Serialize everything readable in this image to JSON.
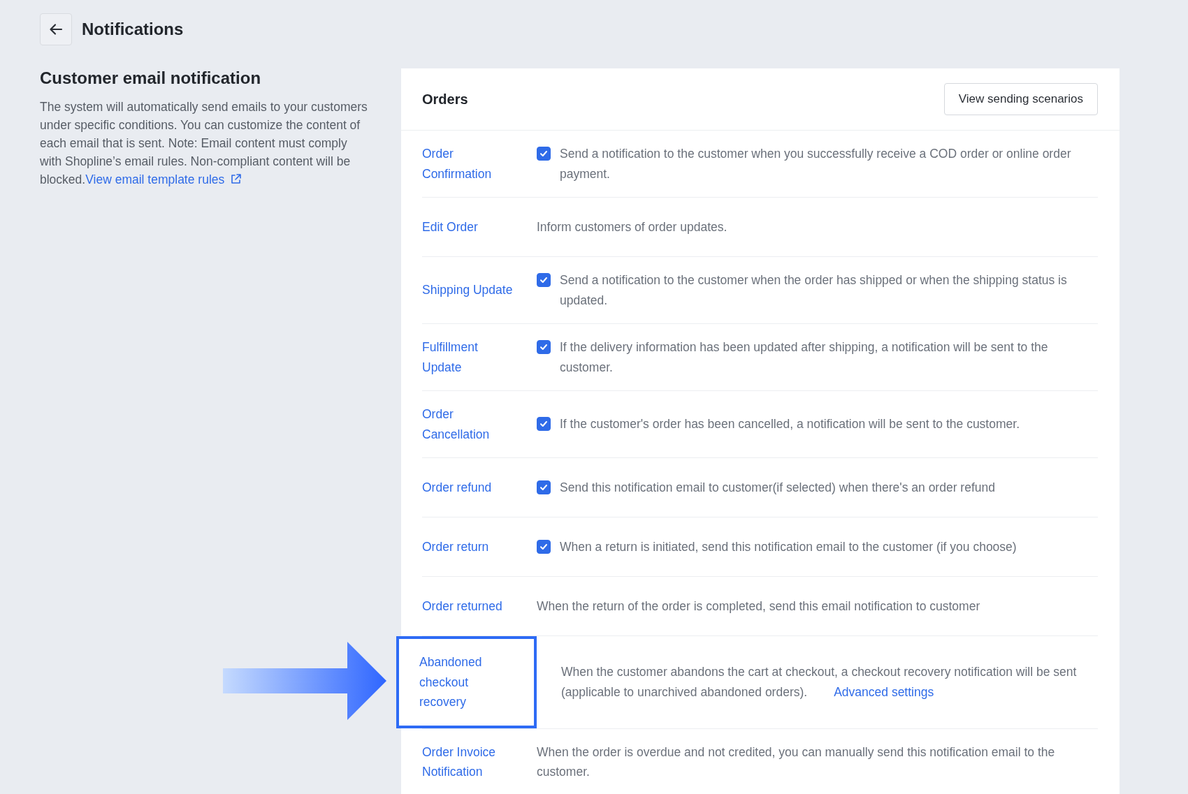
{
  "header": {
    "title": "Notifications"
  },
  "intro": {
    "heading": "Customer email notification",
    "text": "The system will automatically send emails to your customers under specific conditions. You can customize the content of each email that is sent. Note: Email content must comply with Shopline’s email rules. Non-compliant content will be blocked.",
    "link": "View email template rules"
  },
  "card": {
    "title": "Orders",
    "button": "View sending scenarios",
    "rows": [
      {
        "label": "Order Confirmation",
        "kind": "checkbox",
        "checked": true,
        "highlighted": false,
        "description": "Send a notification to the customer when you successfully receive a COD order or online order payment."
      },
      {
        "label": "Edit Order",
        "kind": "plain",
        "highlighted": false,
        "description": "Inform customers of order updates."
      },
      {
        "label": "Shipping Update",
        "kind": "checkbox",
        "checked": true,
        "highlighted": false,
        "description": "Send a notification to the customer when the order has shipped or when the shipping status is updated."
      },
      {
        "label": "Fulfillment Update",
        "kind": "checkbox",
        "checked": true,
        "highlighted": false,
        "description": "If the delivery information has been updated after shipping, a notification will be sent to the customer."
      },
      {
        "label": "Order Cancellation",
        "kind": "checkbox",
        "checked": true,
        "highlighted": false,
        "description": "If the customer's order has been cancelled, a notification will be sent to the customer."
      },
      {
        "label": "Order refund",
        "kind": "checkbox",
        "checked": true,
        "highlighted": false,
        "description": "Send this notification email to customer(if selected) when there's an order refund"
      },
      {
        "label": "Order return",
        "kind": "checkbox",
        "checked": true,
        "highlighted": false,
        "description": "When a return is initiated, send this notification email to the customer (if you choose)"
      },
      {
        "label": "Order returned",
        "kind": "plain",
        "highlighted": false,
        "description": "When the return of the order is completed, send this email notification to customer"
      },
      {
        "label": "Abandoned checkout recovery",
        "kind": "plain",
        "highlighted": true,
        "description": "When the customer abandons the cart at checkout, a checkout recovery notification will be sent (applicable to unarchived abandoned orders).",
        "link": "Advanced settings"
      },
      {
        "label": "Order Invoice Notification",
        "kind": "plain",
        "highlighted": false,
        "description": "When the order is overdue and not credited, you can manually send this notification email to the customer."
      }
    ]
  }
}
